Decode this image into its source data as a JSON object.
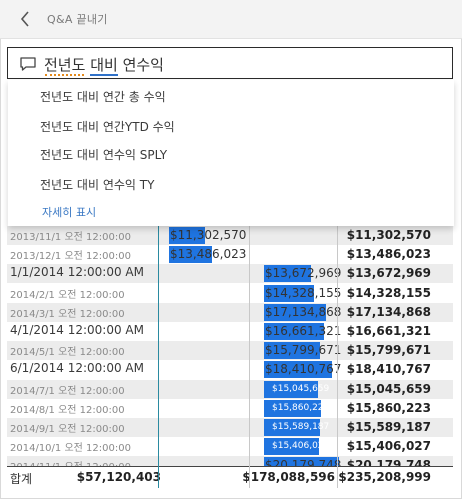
{
  "header": {
    "exit_label": "Q&A 끝내기"
  },
  "question": {
    "word1": "전년도",
    "word2": "대비",
    "rest": " 연수익"
  },
  "suggestions": {
    "items": [
      "전년도 대비 연간 총 수익",
      "전년도 대비 연간YTD 수익",
      "전년도 대비 연수익 SPLY",
      "전년도 대비 연수익 TY"
    ],
    "more": "자세히 표시"
  },
  "table": {
    "rows": [
      {
        "date": "2013/11/1 오전 12:00:00",
        "col1": "$11,302,570",
        "col1_bar": 0.45,
        "col2": "",
        "col2_bar": 0,
        "total": "$11,302,570"
      },
      {
        "date": "2013/12/1 오전 12:00:00",
        "col1": "$13,486,023",
        "col1_bar": 0.54,
        "col2": "",
        "col2_bar": 0,
        "total": "$13,486,023"
      },
      {
        "date": "1/1/2014 12:00:00 AM",
        "col1": "",
        "col1_bar": 0,
        "col2": "$13,672,969",
        "col2_bar": 0.62,
        "total": "$13,672,969"
      },
      {
        "date": "2014/2/1 오전 12:00:00",
        "col1": "",
        "col1_bar": 0,
        "col2": "$14,328,155",
        "col2_bar": 0.66,
        "total": "$14,328,155"
      },
      {
        "date": "2014/3/1 오전 12:00:00",
        "col1": "",
        "col1_bar": 0,
        "col2": "$17,134,868",
        "col2_bar": 0.83,
        "total": "$17,134,868"
      },
      {
        "date": "4/1/2014 12:00:00 AM",
        "col1": "",
        "col1_bar": 0,
        "col2": "$16,661,321",
        "col2_bar": 0.8,
        "total": "$16,661,321"
      },
      {
        "date": "2014/5/1 오전 12:00:00",
        "col1": "",
        "col1_bar": 0,
        "col2": "$15,799,671",
        "col2_bar": 0.75,
        "total": "$15,799,671"
      },
      {
        "date": "6/1/2014 12:00:00 AM",
        "col1": "",
        "col1_bar": 0,
        "col2": "$18,410,767",
        "col2_bar": 0.9,
        "total": "$18,410,767"
      },
      {
        "date": "2014/7/1 오전 12:00:00",
        "col1": "",
        "col1_bar": 0,
        "col2": "$15,045,659",
        "col2_bar": 0.72,
        "total": "$15,045,659"
      },
      {
        "date": "2014/8/1 오전 12:00:00",
        "col1": "",
        "col1_bar": 0,
        "col2": "$15,860,223",
        "col2_bar": 0.76,
        "total": "$15,860,223"
      },
      {
        "date": "2014/9/1 오전 12:00:00",
        "col1": "",
        "col1_bar": 0,
        "col2": "$15,589,187",
        "col2_bar": 0.74,
        "total": "$15,589,187"
      },
      {
        "date": "2014/10/1 오전 12:00:00",
        "col1": "",
        "col1_bar": 0,
        "col2": "$15,406,027",
        "col2_bar": 0.73,
        "total": "$15,406,027"
      },
      {
        "date": "2014/11/1 오전 12:00:00",
        "col1": "",
        "col1_bar": 0,
        "col2": "$20,179,748",
        "col2_bar": 1.0,
        "total": "$20,179,748"
      }
    ],
    "totals": {
      "label": "합계",
      "col1": "$57,120,403",
      "col2": "$178,088,596",
      "total": "$235,208,999"
    }
  },
  "colors": {
    "bar": "#1f74e0",
    "divider": "#2a8aa0"
  }
}
